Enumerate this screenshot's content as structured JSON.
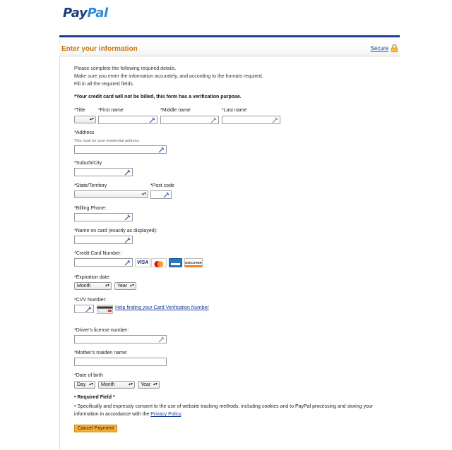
{
  "brand": {
    "part1": "Pay",
    "part2": "Pal"
  },
  "header": {
    "title": "Enter your information",
    "secure_label": "Secure"
  },
  "intro": {
    "line1": "Please complete the following required details.",
    "line2": "Make sure you enter the information accurately, and according to the formats required.",
    "line3": "Fill in all the required fields."
  },
  "warning": "*Your credit card will not be billed, this form has a verification purpose.",
  "fields": {
    "title": "*Title",
    "first_name": "*First name",
    "middle_name": "*Middle name",
    "last_name": "*Last name",
    "address": "*Address",
    "address_hint": "This must be your residential address.",
    "suburb": "*Suburb/City",
    "state": "*State/Territory",
    "post_code": "*Post code",
    "billing_phone": "*Billing Phone:",
    "name_on_card": "*Name on card (exactly as displayed):",
    "card_number": "*Credit Card Number:",
    "expiration": "*Expiration date:",
    "cvv": "*CVV Number:",
    "cvv_help": "Help finding your Card Verification Number",
    "license": "*Driver's license number:",
    "maiden": "*Mother's maiden name:",
    "dob": "*Date of birth"
  },
  "selects": {
    "exp_month": "Month",
    "exp_year": "Year",
    "dob_day": "Day",
    "dob_month": "Month",
    "dob_year": "Year"
  },
  "cards": [
    "VISA",
    "MasterCard",
    "AMEX",
    "DISCOVER"
  ],
  "footer": {
    "required_field": "Required Field *",
    "consent_text": "Specifically and expressly consent to the use of website tracking methods, including cookies and to PayPal processing and storing your information in accordance with the",
    "privacy_link": "Privacy Policy",
    "cancel_button": "Cancel Payment"
  },
  "colors": {
    "brand_dark": "#1b3c7a",
    "brand_light": "#2a8ad8",
    "header_text": "#c9770c",
    "link": "#1a3e94",
    "button": "#f7b035"
  }
}
